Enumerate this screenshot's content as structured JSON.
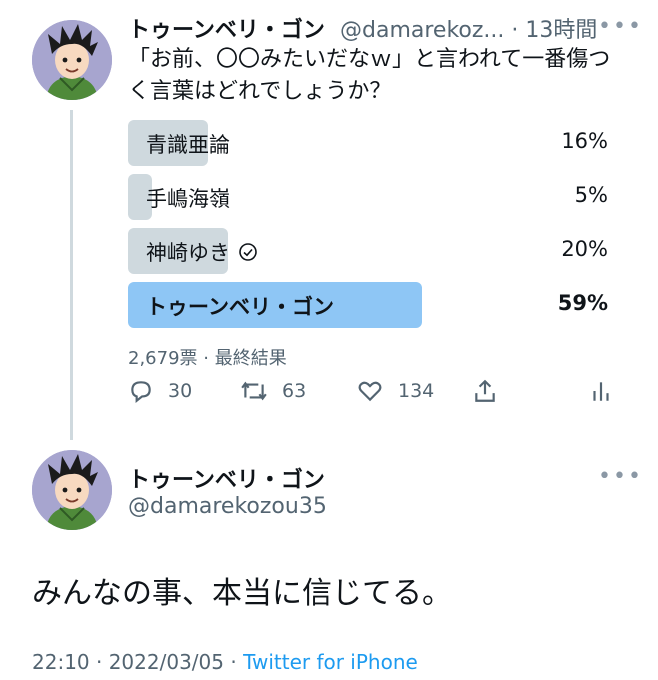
{
  "tweet1": {
    "name": "トゥーンベリ・ゴン",
    "handle_time": "@damarekoz... · 13時間",
    "text_line1": "「お前、〇〇みたいだなｗ」と言われて一番傷つ",
    "text_line2": "く言葉はどれでしょうか？",
    "poll": {
      "options": [
        {
          "label": "青識亜論",
          "percent": "16%",
          "value": 16
        },
        {
          "label": "手嶋海嶺",
          "percent": "5%",
          "value": 5
        },
        {
          "label": "神崎ゆき",
          "percent": "20%",
          "value": 20
        },
        {
          "label": "トゥーンベリ・ゴン",
          "percent": "59%",
          "value": 59
        }
      ],
      "summary": "2,679票 · 最終結果"
    },
    "actions": {
      "replies": "30",
      "retweets": "63",
      "likes": "134"
    }
  },
  "tweet2": {
    "name": "トゥーンベリ・ゴン",
    "handle": "@damarekozou35",
    "text": "みんなの事、本当に信じてる。",
    "timestamp": "22:10 · 2022/03/05 · ",
    "source": "Twitter for iPhone"
  },
  "more_label": "•••",
  "colors": {
    "winner_bar": "#8ec6f5",
    "bar": "#cfd9de",
    "link": "#1d9bf0"
  }
}
